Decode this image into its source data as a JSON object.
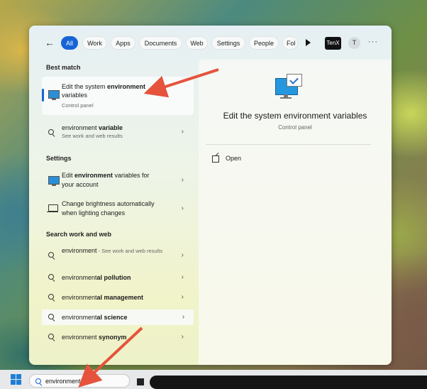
{
  "filters": {
    "back_label": "←",
    "chips": [
      "All",
      "Work",
      "Apps",
      "Documents",
      "Web",
      "Settings",
      "People",
      "Fol"
    ],
    "active_chip": "All",
    "badge": "TenX",
    "avatar_initial": "T",
    "more": "···"
  },
  "results": {
    "best_match_heading": "Best match",
    "best_match": {
      "title_pre": "Edit the system ",
      "title_bold": "environment",
      "title_post": " variables",
      "subtitle": "Control panel"
    },
    "env_var": {
      "pre": "environment ",
      "bold": "variable",
      "subtitle": "See work and web results"
    },
    "settings_heading": "Settings",
    "settings_items": [
      {
        "pre": "Edit ",
        "bold": "environment",
        "post": " variables for your account"
      },
      {
        "text": "Change brightness automatically when lighting changes"
      }
    ],
    "web_heading": "Search work and web",
    "web_items": [
      {
        "pre": "environment",
        "bold": "",
        "suffix": " - See work and web results"
      },
      {
        "pre": "environment",
        "bold": "al pollution"
      },
      {
        "pre": "environment",
        "bold": "al management"
      },
      {
        "pre": "environment",
        "bold": "al science"
      },
      {
        "pre": "environment",
        "bold": " synonym"
      }
    ],
    "chevron": "›"
  },
  "detail": {
    "title": "Edit the system environment variables",
    "subtitle": "Control panel",
    "open_label": "Open"
  },
  "taskbar": {
    "search_value": "environment"
  },
  "colors": {
    "accent": "#1764d6",
    "annotation_arrow": "#e5533d"
  }
}
